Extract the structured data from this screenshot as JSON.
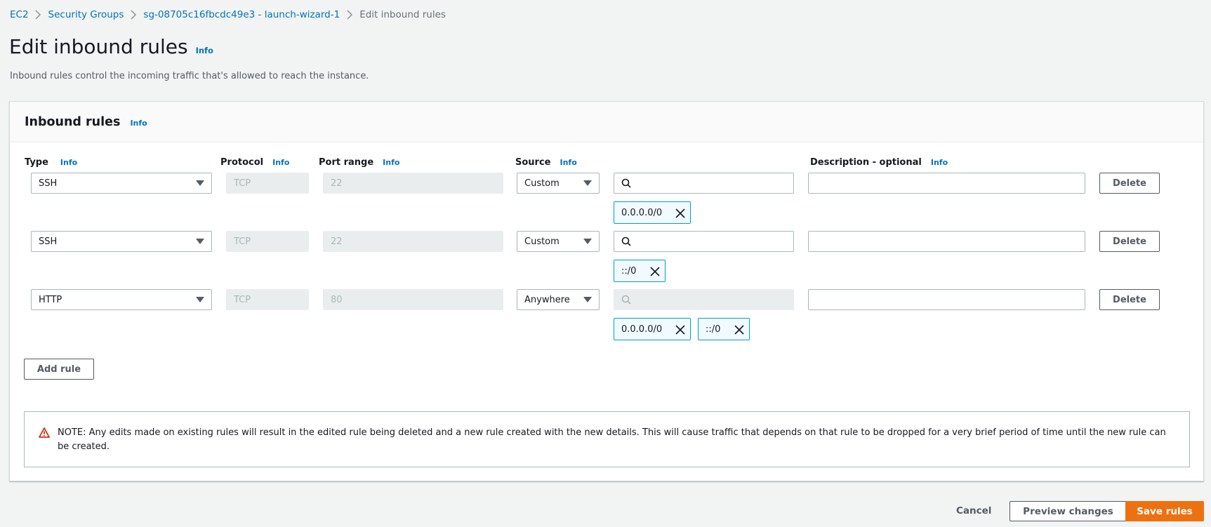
{
  "breadcrumb": {
    "items": [
      "EC2",
      "Security Groups",
      "sg-08705c16fbcdc49e3 - launch-wizard-1"
    ],
    "current": "Edit inbound rules"
  },
  "page": {
    "title": "Edit inbound rules",
    "info": "Info",
    "description": "Inbound rules control the incoming traffic that's allowed to reach the instance."
  },
  "panel": {
    "title": "Inbound rules",
    "info": "Info",
    "columns": {
      "type": "Type",
      "protocol": "Protocol",
      "port_range": "Port range",
      "source": "Source",
      "description": "Description - optional",
      "info": "Info"
    },
    "rules": [
      {
        "type": "SSH",
        "protocol": "TCP",
        "port_range": "22",
        "source": "Custom",
        "tokens": [
          "0.0.0.0/0"
        ],
        "description": "",
        "delete": "Delete"
      },
      {
        "type": "SSH",
        "protocol": "TCP",
        "port_range": "22",
        "source": "Custom",
        "tokens": [
          "::/0"
        ],
        "description": "",
        "delete": "Delete"
      },
      {
        "type": "HTTP",
        "protocol": "TCP",
        "port_range": "80",
        "source": "Anywhere",
        "tokens": [
          "0.0.0.0/0",
          "::/0"
        ],
        "description": "",
        "delete": "Delete"
      }
    ],
    "add_rule": "Add rule",
    "note": "NOTE: Any edits made on existing rules will result in the edited rule being deleted and a new rule created with the new details. This will cause traffic that depends on that rule to be dropped for a very brief period of time until the new rule can be created."
  },
  "footer": {
    "cancel": "Cancel",
    "preview": "Preview changes",
    "save": "Save rules"
  },
  "colors": {
    "link": "#0073bb",
    "primary": "#ec7211",
    "token_border": "#00a1c9",
    "warning": "#d13212"
  },
  "icons": [
    "chevron-right-icon",
    "caret-down-icon",
    "search-icon",
    "close-icon",
    "warning-icon"
  ]
}
